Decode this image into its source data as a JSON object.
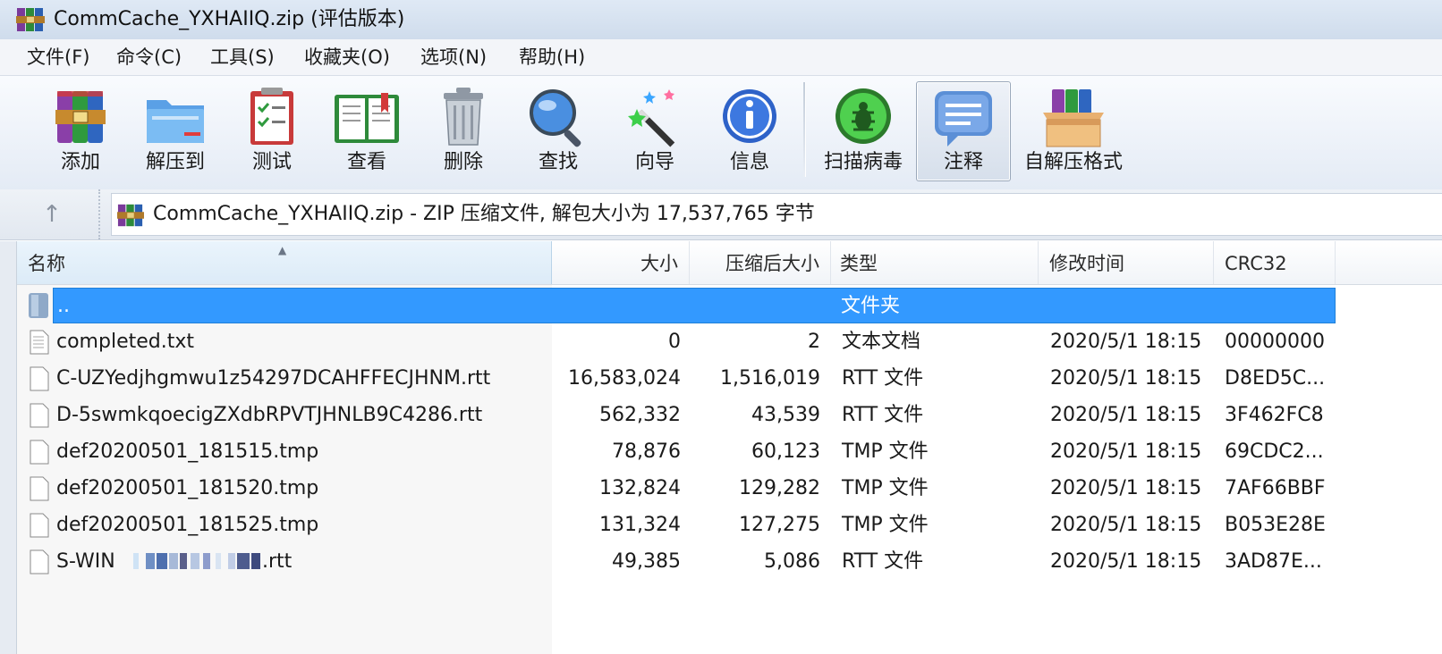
{
  "window": {
    "title": "CommCache_YXHAIIQ.zip (评估版本)"
  },
  "menu": [
    "文件(F)",
    "命令(C)",
    "工具(S)",
    "收藏夹(O)",
    "选项(N)",
    "帮助(H)"
  ],
  "toolbar": {
    "add": "添加",
    "extract": "解压到",
    "test": "测试",
    "view": "查看",
    "delete": "删除",
    "find": "查找",
    "wizard": "向导",
    "info": "信息",
    "virus_scan": "扫描病毒",
    "comment": "注释",
    "sfx": "自解压格式"
  },
  "address": {
    "text": "CommCache_YXHAIIQ.zip - ZIP 压缩文件, 解包大小为 17,537,765 字节"
  },
  "columns": {
    "name": "名称",
    "size": "大小",
    "packed": "压缩后大小",
    "type": "类型",
    "modified": "修改时间",
    "crc": "CRC32"
  },
  "files": [
    {
      "name": "..",
      "size": "",
      "packed": "",
      "type": "文件夹",
      "modified": "",
      "crc": ""
    },
    {
      "name": "completed.txt",
      "size": "0",
      "packed": "2",
      "type": "文本文档",
      "modified": "2020/5/1 18:15",
      "crc": "00000000"
    },
    {
      "name": "C-UZYedjhgmwu1z54297DCAHFFECJHNM.rtt",
      "size": "16,583,024",
      "packed": "1,516,019",
      "type": "RTT 文件",
      "modified": "2020/5/1 18:15",
      "crc": "D8ED5C..."
    },
    {
      "name": "D-5swmkqoecigZXdbRPVTJHNLB9C4286.rtt",
      "size": "562,332",
      "packed": "43,539",
      "type": "RTT 文件",
      "modified": "2020/5/1 18:15",
      "crc": "3F462FC8"
    },
    {
      "name": "def20200501_181515.tmp",
      "size": "78,876",
      "packed": "60,123",
      "type": "TMP 文件",
      "modified": "2020/5/1 18:15",
      "crc": "69CDC2..."
    },
    {
      "name": "def20200501_181520.tmp",
      "size": "132,824",
      "packed": "129,282",
      "type": "TMP 文件",
      "modified": "2020/5/1 18:15",
      "crc": "7AF66BBF"
    },
    {
      "name": "def20200501_181525.tmp",
      "size": "131,324",
      "packed": "127,275",
      "type": "TMP 文件",
      "modified": "2020/5/1 18:15",
      "crc": "B053E28E"
    },
    {
      "name_prefix": "S-WIN",
      "name_suffix": ".rtt",
      "size": "49,385",
      "packed": "5,086",
      "type": "RTT 文件",
      "modified": "2020/5/1 18:15",
      "crc": "3AD87E..."
    }
  ],
  "colors": {
    "selection": "#3399ff",
    "title_bar": "#dfe9f5"
  }
}
